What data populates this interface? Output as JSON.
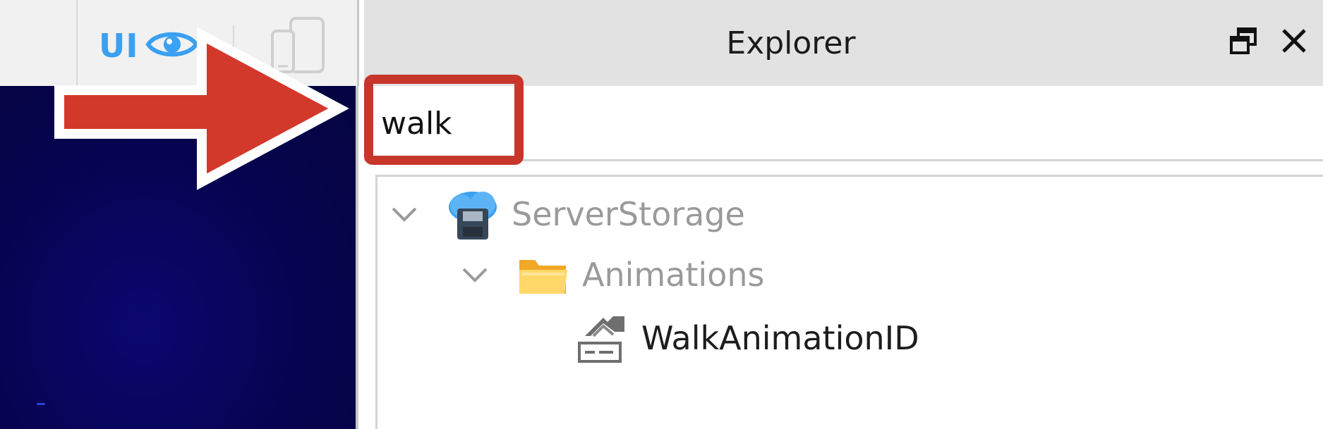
{
  "toolbar": {
    "ui_label": "UI",
    "ui_icon": "eye-icon",
    "device_icon": "device-emulator-icon",
    "accent_color": "#3aa0f2"
  },
  "explorer": {
    "title": "Explorer",
    "undock_icon": "undock-icon",
    "close_icon": "close-icon",
    "search": {
      "value": "walk",
      "placeholder": ""
    },
    "tree": [
      {
        "label": "ServerStorage",
        "icon": "server-storage-icon",
        "expanded": true,
        "dimmed": true
      },
      {
        "label": "Animations",
        "icon": "folder-icon",
        "expanded": true,
        "dimmed": true
      },
      {
        "label": "WalkAnimationID",
        "icon": "string-value-icon",
        "expanded": false,
        "dimmed": false
      }
    ]
  },
  "annotation": {
    "arrow_icon": "red-arrow-icon",
    "highlight_color": "#c7362b"
  },
  "viewport": {
    "background_color": "#06044f"
  }
}
